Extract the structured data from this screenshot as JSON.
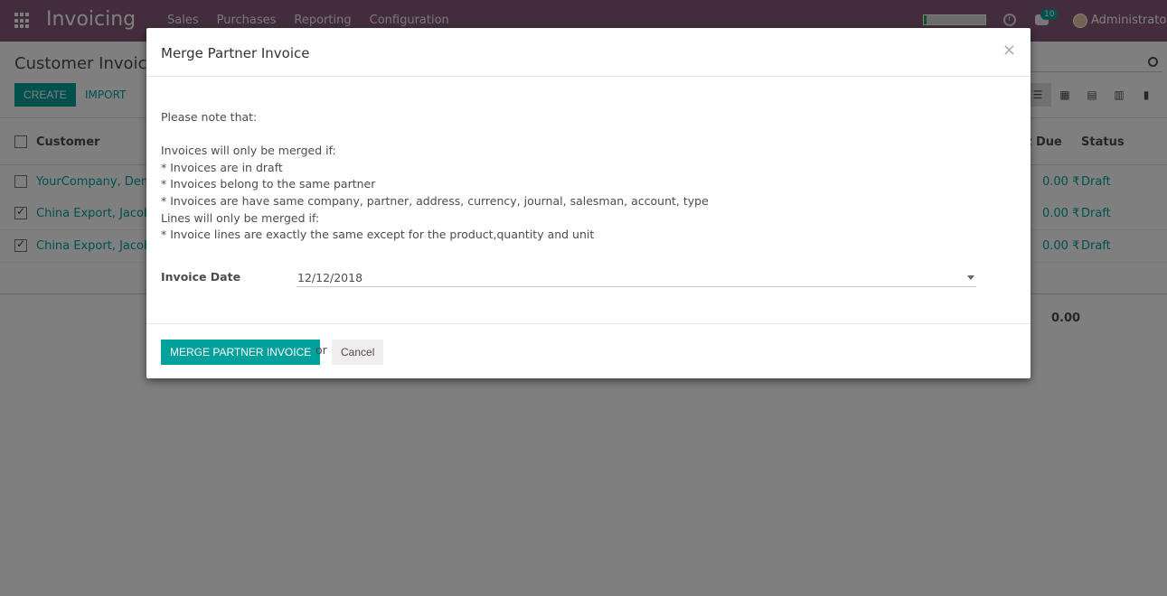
{
  "navbar": {
    "app_name": "Invoicing",
    "menu": [
      "Sales",
      "Purchases",
      "Reporting",
      "Configuration"
    ],
    "progress_fraction": 0.05,
    "notification_count": "10",
    "user": "Administrator",
    "color": "#875a7b"
  },
  "control_panel": {
    "breadcrumb": "Customer Invoices",
    "create_label": "CREATE",
    "import_label": "IMPORT",
    "views": [
      "list-view-icon",
      "kanban-view-icon",
      "calendar-view-icon",
      "pivot-view-icon",
      "graph-view-icon"
    ]
  },
  "list": {
    "headers": {
      "customer": "Customer",
      "amount_due": "nt Due",
      "status": "Status"
    },
    "rows": [
      {
        "customer": "YourCompany, Demo",
        "amount": "0.00 ₹",
        "status": "Draft",
        "checked": false
      },
      {
        "customer": "China Export, Jacob T",
        "amount": "0.00 ₹",
        "status": "Draft",
        "checked": true
      },
      {
        "customer": "China Export, Jacob T",
        "amount": "0.00 ₹",
        "status": "Draft",
        "checked": true
      }
    ],
    "total": "0.00"
  },
  "modal": {
    "title": "Merge Partner Invoice",
    "close": "×",
    "note_lines": [
      "Please note that:",
      "",
      "Invoices will only be merged if:",
      "* Invoices are in draft",
      "* Invoices belong to the same partner",
      "* Invoices are have same company, partner, address, currency, journal, salesman, account, type",
      "Lines will only be merged if:",
      "* Invoice lines are exactly the same except for the product,quantity and unit"
    ],
    "field_label": "Invoice Date",
    "field_value": "12/12/2018",
    "primary_button": "MERGE PARTNER INVOICE",
    "or_text": "or",
    "cancel_button": "Cancel",
    "accent": "#00a09d"
  }
}
